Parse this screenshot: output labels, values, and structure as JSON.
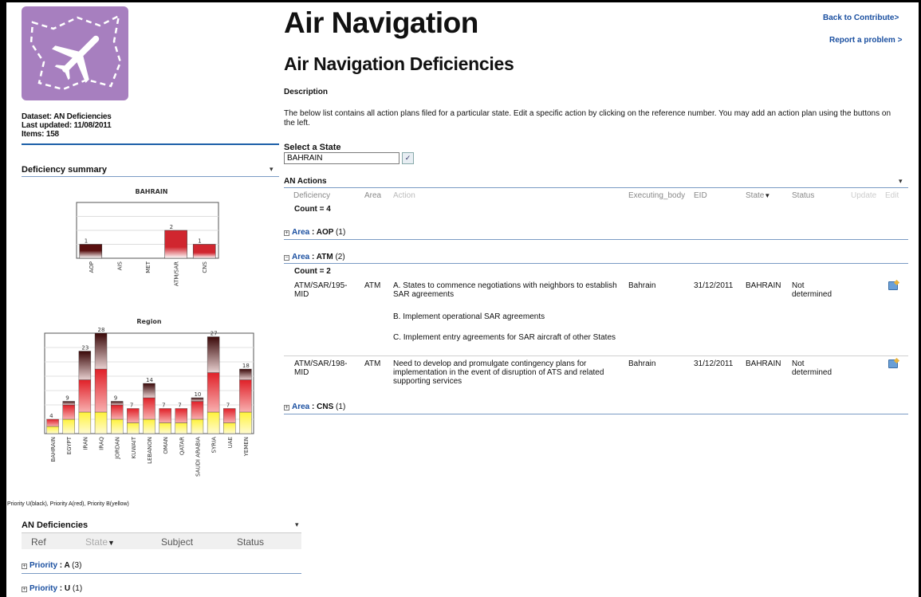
{
  "dataset": {
    "name_line": "Dataset: AN Deficiencies",
    "updated_line": "Last updated: 11/08/2011",
    "items_line": "Items: 158"
  },
  "summary_panel": {
    "title": "Deficiency summary",
    "caret": "▾"
  },
  "chart_data": [
    {
      "type": "bar",
      "title": "BAHRAIN",
      "categories": [
        "AOP",
        "AIS",
        "MET",
        "ATM/SAR",
        "CNS"
      ],
      "values": [
        1,
        0,
        0,
        2,
        1
      ],
      "ylim": [
        0,
        4
      ],
      "grid": true,
      "colors": {
        "dark": "#5a1010",
        "mid": "#d0262f",
        "low": "#ffffff"
      }
    },
    {
      "type": "bar",
      "title": "Region",
      "categories": [
        "BAHRAIN",
        "EGYPT",
        "IRAN",
        "IRAQ",
        "JORDAN",
        "KUWAIT",
        "LEBANON",
        "OMAN",
        "QATAR",
        "SAUDI ARABIA",
        "SYRIA",
        "UAE",
        "YEMEN"
      ],
      "values": [
        4,
        9,
        23,
        28,
        9,
        7,
        14,
        7,
        7,
        10,
        27,
        7,
        18
      ],
      "series": [
        {
          "name": "Priority U",
          "values": [
            0,
            1,
            8,
            10,
            1,
            0,
            4,
            0,
            0,
            1,
            10,
            0,
            3
          ]
        },
        {
          "name": "Priority A",
          "values": [
            2,
            4,
            9,
            12,
            4,
            4,
            6,
            4,
            4,
            5,
            11,
            4,
            9
          ]
        },
        {
          "name": "Priority B",
          "values": [
            2,
            4,
            6,
            6,
            4,
            3,
            4,
            3,
            3,
            4,
            6,
            3,
            6
          ]
        }
      ],
      "ylim": [
        0,
        28
      ],
      "grid": true,
      "colors": {
        "U": "#3a0808",
        "A": "#e02028",
        "B": "#fff23a"
      }
    }
  ],
  "legend_text": "Priority U(black), Priority A(red), Priority B(yellow)",
  "deficiencies_panel": {
    "title": "AN Deficiencies",
    "caret": "▾",
    "columns": [
      "Ref",
      "State",
      "Subject",
      "Status"
    ],
    "groups": [
      {
        "label": "Priority",
        "sep": " : ",
        "value": "A",
        "count": "(3)"
      },
      {
        "label": "Priority",
        "sep": " : ",
        "value": "U",
        "count": "(1)"
      }
    ]
  },
  "header": {
    "title": "Air Navigation",
    "subtitle": "Air Navigation Deficiencies",
    "back_link": "Back to Contribute>",
    "report_link": "Report a problem >"
  },
  "description": {
    "heading": "Description",
    "text": "The below list contains all action plans filed for a particular state. Edit a specific action by clicking on the reference number. You may add an action plan using the buttons on the left."
  },
  "state_select": {
    "label": "Select a State",
    "value": "BAHRAIN"
  },
  "actions": {
    "title": "AN Actions",
    "caret": "▾",
    "columns": {
      "deficiency": "Deficiency",
      "area": "Area",
      "action": "Action",
      "executing_body": "Executing_body",
      "eid": "EID",
      "state": "State",
      "status": "Status",
      "update": "Update",
      "edit": "Edit"
    },
    "count_total": "Count = 4",
    "group_label": "Area",
    "group_sep": " : ",
    "groups": [
      {
        "value": "AOP",
        "count": "(1)",
        "expanded": false
      },
      {
        "value": "ATM",
        "count": "(2)",
        "expanded": true,
        "count_line": "Count = 2"
      },
      {
        "value": "CNS",
        "count": "(1)",
        "expanded": false
      }
    ],
    "rows": [
      {
        "deficiency": "ATM/SAR/195-MID",
        "area": "ATM",
        "actions": [
          "A.  States to commence negotiations with neighbors to establish SAR agreements",
          "B.  Implement operational SAR agreements",
          "C.  Implement entry agreements for SAR aircraft of other States"
        ],
        "executing_body": "Bahrain",
        "eid": "31/12/2011",
        "state": "BAHRAIN",
        "status": "Not determined"
      },
      {
        "deficiency": "ATM/SAR/198-MID",
        "area": "ATM",
        "actions": [
          "Need to develop and promulgate contingency plans for implementation in the event of disruption of ATS and related supporting services"
        ],
        "executing_body": "Bahrain",
        "eid": "31/12/2011",
        "state": "BAHRAIN",
        "status": "Not determined"
      }
    ]
  }
}
